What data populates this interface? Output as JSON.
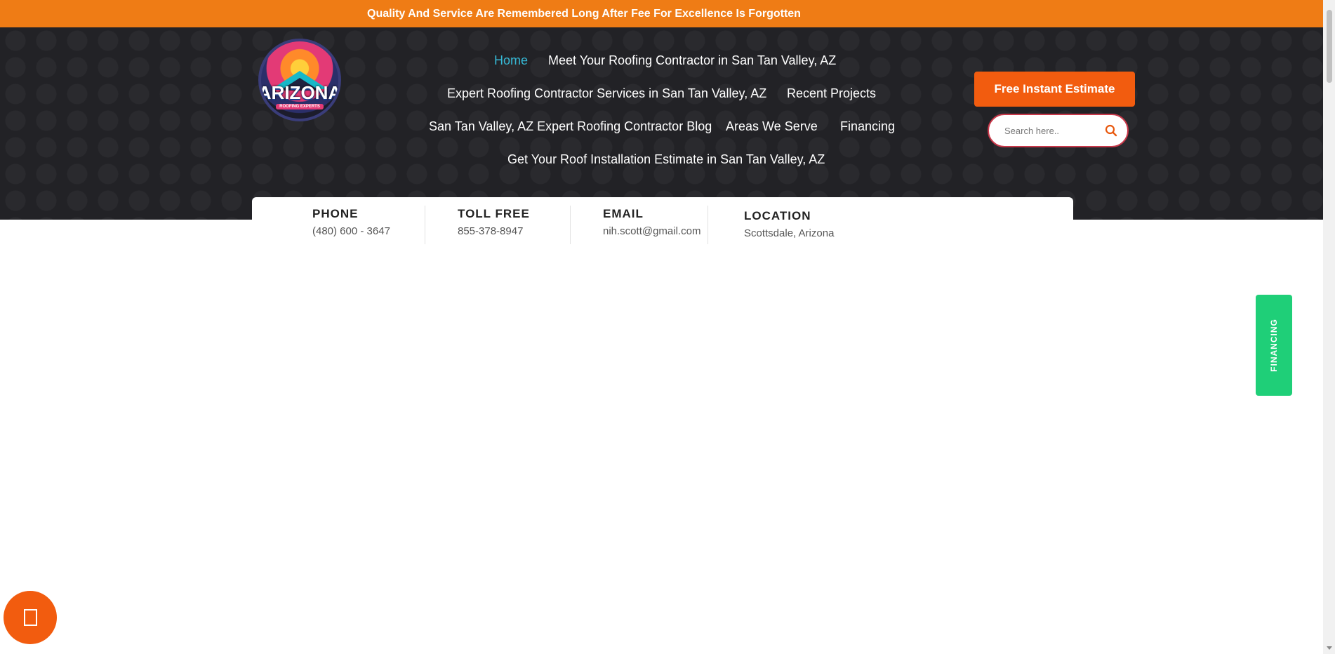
{
  "topbar": {
    "tagline": "Quality And Service Are Remembered Long After Fee For Excellence Is Forgotten"
  },
  "logo": {
    "text": "ARIZONA",
    "subtext": "ROOFING EXPERTS"
  },
  "nav": {
    "items": [
      {
        "label": "Home",
        "active": true
      },
      {
        "label": "Meet Your Roofing Contractor in San Tan Valley, AZ"
      },
      {
        "label": "Expert Roofing Contractor Services in San Tan Valley, AZ"
      },
      {
        "label": "Recent Projects"
      },
      {
        "label": "San Tan Valley, AZ Expert Roofing Contractor Blog"
      },
      {
        "label": "Areas We Serve"
      },
      {
        "label": "Financing"
      },
      {
        "label": "Get Your Roof Installation Estimate in San Tan Valley, AZ"
      }
    ]
  },
  "estimate": {
    "label": "Free Instant Estimate"
  },
  "search": {
    "placeholder": "Search here.."
  },
  "contact": {
    "phone": {
      "label": "PHONE",
      "value": "(480) 600 - 3647"
    },
    "tollfree": {
      "label": "TOLL FREE",
      "value": "855-378-8947"
    },
    "email": {
      "label": "EMAIL",
      "value": "nih.scott@gmail.com"
    },
    "location": {
      "label": "LOCATION",
      "value": "Scottsdale, Arizona"
    }
  },
  "financing_tab": {
    "label": "FINANCING"
  },
  "colors": {
    "topbar": "#ef7c15",
    "header": "#222226",
    "accent": "#f25c0f",
    "nav_active": "#36b9d6",
    "financing": "#1fcf78"
  }
}
